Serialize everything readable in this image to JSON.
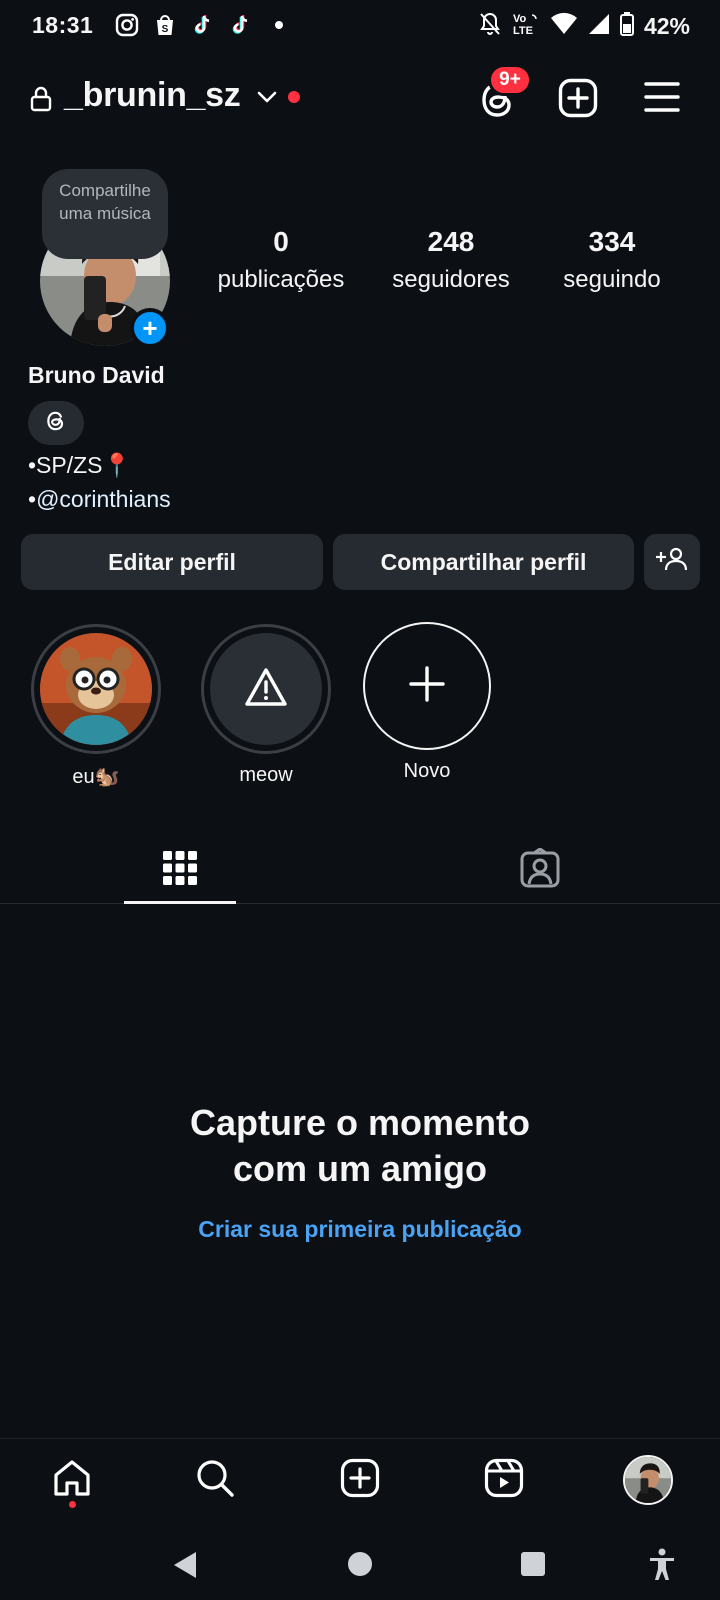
{
  "status_bar": {
    "time": "18:31",
    "app_icons": [
      "instagram-icon",
      "shopee-icon",
      "tiktok-icon",
      "tiktok-icon"
    ],
    "network_label": "Vo LTE",
    "battery": "42%"
  },
  "header": {
    "username": "_brunin_sz",
    "threads_badge": "9+"
  },
  "profile": {
    "note": "Compartilhe uma música",
    "stats": [
      {
        "value": "0",
        "label": "publicações"
      },
      {
        "value": "248",
        "label": "seguidores"
      },
      {
        "value": "334",
        "label": "seguindo"
      }
    ],
    "full_name": "Bruno David",
    "bio_line1": "•SP/ZS📍",
    "bio_prefix": "•",
    "bio_mention": "@corinthians"
  },
  "buttons": {
    "edit": "Editar perfil",
    "share": "Compartilhar perfil"
  },
  "highlights": [
    {
      "label": "eu🐿️"
    },
    {
      "label": "meow"
    },
    {
      "label": "Novo"
    }
  ],
  "empty_state": {
    "title_line1": "Capture o momento",
    "title_line2": "com um amigo",
    "link": "Criar sua primeira publicação"
  },
  "colors": {
    "background": "#0c0f14",
    "accent_blue": "#0095f6",
    "link_blue": "#4aa3f5",
    "notification_red": "#ff3040"
  }
}
